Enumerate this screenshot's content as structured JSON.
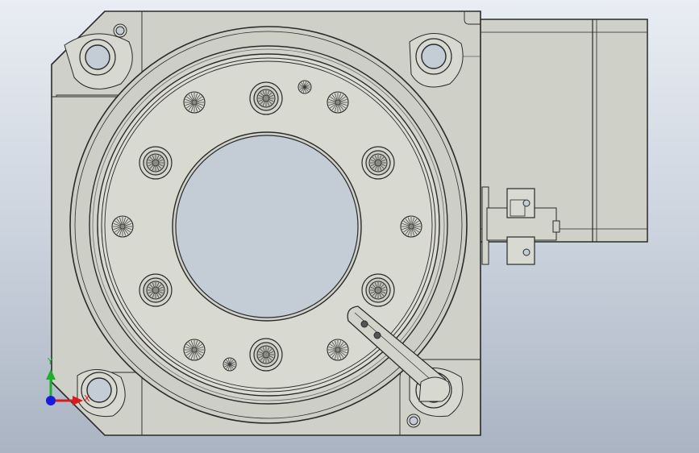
{
  "viewport": {
    "background_top": "#e9edf3",
    "background_bottom": "#aab4c2",
    "part_fill": "#cfd0c8",
    "part_fill_light": "#dcdcd4",
    "edge_color": "#2a2a2a",
    "hole_fill": "#c4ccd6"
  },
  "triad": {
    "x_label": "X",
    "y_label": "Y",
    "x_color": "#d81c1c",
    "y_color": "#1fae2a",
    "z_color": "#1a1adf"
  }
}
